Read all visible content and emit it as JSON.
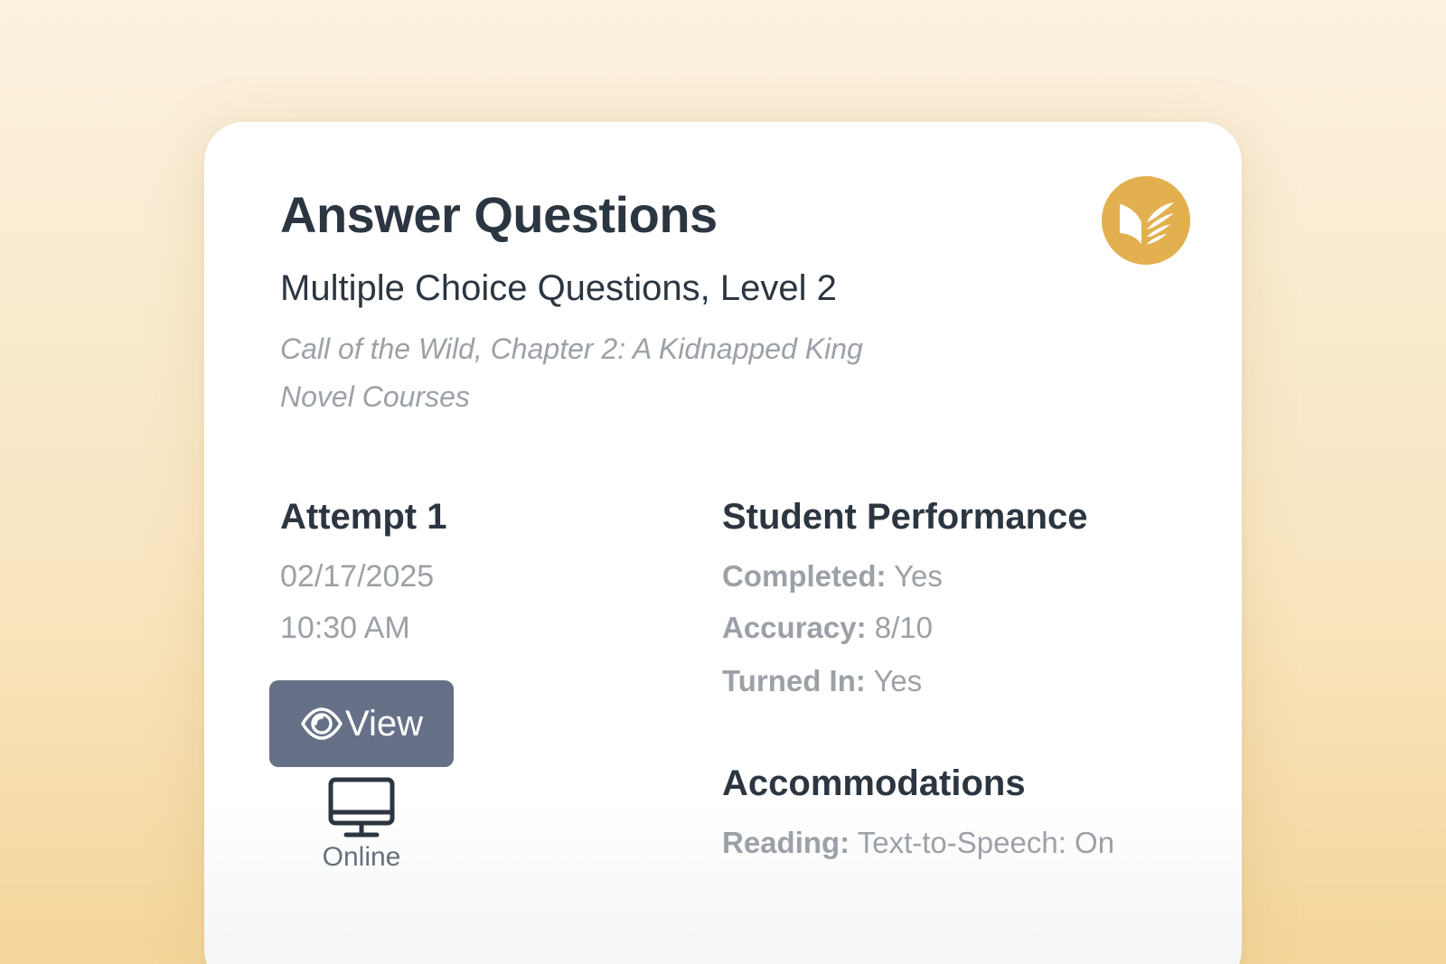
{
  "colors": {
    "accent": "#e3b04f",
    "button": "#667086",
    "heading": "#2c3641",
    "muted": "#9ca1a7"
  },
  "logo": {
    "icon": "wing-book-icon"
  },
  "header": {
    "title": "Answer Questions",
    "subtitle": "Multiple Choice Questions, Level 2",
    "book": "Call of the Wild, Chapter 2: A Kidnapped King",
    "course": "Novel Courses"
  },
  "attempt": {
    "heading": "Attempt 1",
    "date": "02/17/2025",
    "time": "10:30 AM",
    "view_button": {
      "label": "View",
      "icon": "eye-icon"
    },
    "mode": {
      "label": "Online",
      "icon": "monitor-icon"
    }
  },
  "performance": {
    "heading": "Student Performance",
    "items": [
      {
        "label": "Completed:",
        "value": "Yes"
      },
      {
        "label": "Accuracy:",
        "value": "8/10"
      },
      {
        "label": "Turned In:",
        "value": "Yes"
      }
    ]
  },
  "accommodations": {
    "heading": "Accommodations",
    "items": [
      {
        "label": "Reading:",
        "value": "Text-to-Speech: On"
      }
    ]
  }
}
